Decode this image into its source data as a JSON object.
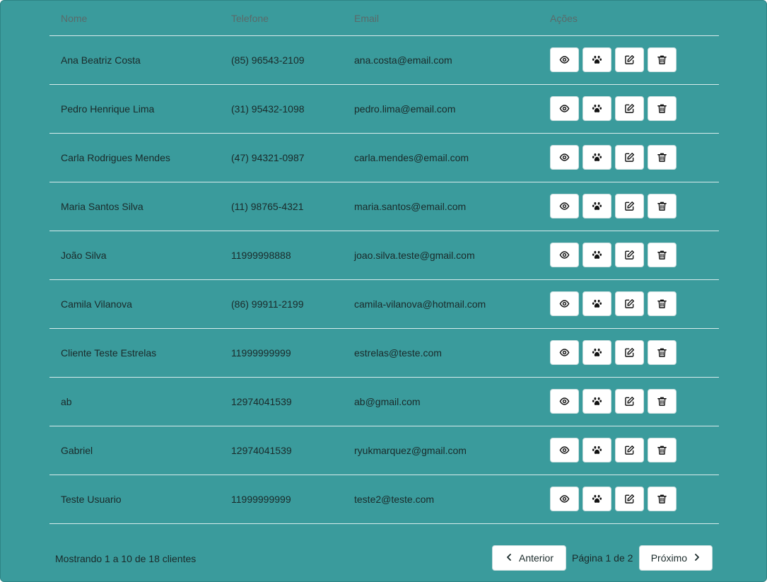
{
  "table": {
    "headers": {
      "nome": "Nome",
      "telefone": "Telefone",
      "email": "Email",
      "acoes": "Ações"
    },
    "rows": [
      {
        "nome": "Ana Beatriz Costa",
        "telefone": "(85) 96543-2109",
        "email": "ana.costa@email.com"
      },
      {
        "nome": "Pedro Henrique Lima",
        "telefone": "(31) 95432-1098",
        "email": "pedro.lima@email.com"
      },
      {
        "nome": "Carla Rodrigues Mendes",
        "telefone": "(47) 94321-0987",
        "email": "carla.mendes@email.com"
      },
      {
        "nome": "Maria Santos Silva",
        "telefone": "(11) 98765-4321",
        "email": "maria.santos@email.com"
      },
      {
        "nome": "João Silva",
        "telefone": "11999998888",
        "email": "joao.silva.teste@gmail.com"
      },
      {
        "nome": "Camila Vilanova",
        "telefone": "(86) 99911-2199",
        "email": "camila-vilanova@hotmail.com"
      },
      {
        "nome": "Cliente Teste Estrelas",
        "telefone": "11999999999",
        "email": "estrelas@teste.com"
      },
      {
        "nome": "ab",
        "telefone": "12974041539",
        "email": "ab@gmail.com"
      },
      {
        "nome": "Gabriel",
        "telefone": "12974041539",
        "email": "ryukmarquez@gmail.com"
      },
      {
        "nome": "Teste Usuario",
        "telefone": "11999999999",
        "email": "teste2@teste.com"
      }
    ],
    "row_actions": [
      "eye-icon",
      "paw-icon",
      "edit-icon",
      "trash-icon"
    ]
  },
  "footer": {
    "info": "Mostrando 1 a 10 de 18 clientes",
    "prev_label": "Anterior",
    "page_text": "Página 1 de 2",
    "next_label": "Próximo"
  },
  "colors": {
    "panel_bg": "#3a9b9c",
    "button_bg": "#ffffff",
    "text": "#1a2a2a"
  }
}
